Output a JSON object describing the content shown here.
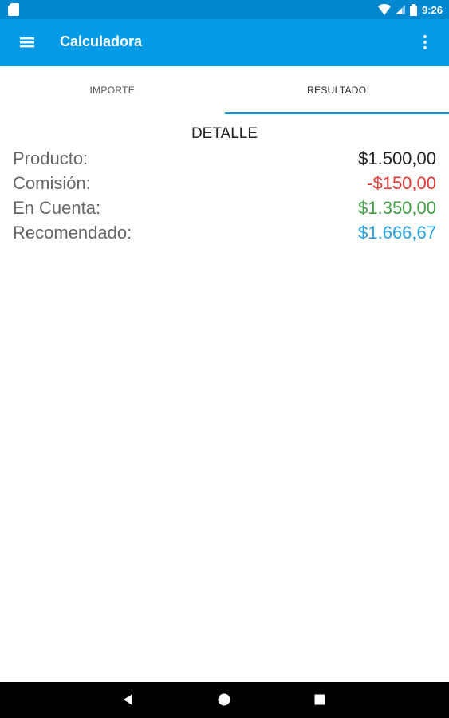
{
  "status_bar": {
    "time": "9:26"
  },
  "app_bar": {
    "title": "Calculadora"
  },
  "tabs": [
    {
      "label": "IMPORTE",
      "active": false
    },
    {
      "label": "RESULTADO",
      "active": true
    }
  ],
  "detail": {
    "title": "DETALLE",
    "rows": [
      {
        "label": "Producto:",
        "value": "$1.500,00",
        "color": "#222222"
      },
      {
        "label": "Comisión:",
        "value": "-$150,00",
        "color": "#e53935"
      },
      {
        "label": "En Cuenta:",
        "value": "$1.350,00",
        "color": "#43a047"
      },
      {
        "label": "Recomendado:",
        "value": "$1.666,67",
        "color": "#29a3e0"
      }
    ]
  },
  "colors": {
    "status_bar": "#0288d1",
    "app_bar": "#039be5",
    "tab_indicator": "#039be5"
  },
  "icons": {
    "menu": "hamburger-icon",
    "more": "more-vert-icon",
    "back": "nav-back-icon",
    "home": "nav-home-icon",
    "recents": "nav-recents-icon"
  }
}
